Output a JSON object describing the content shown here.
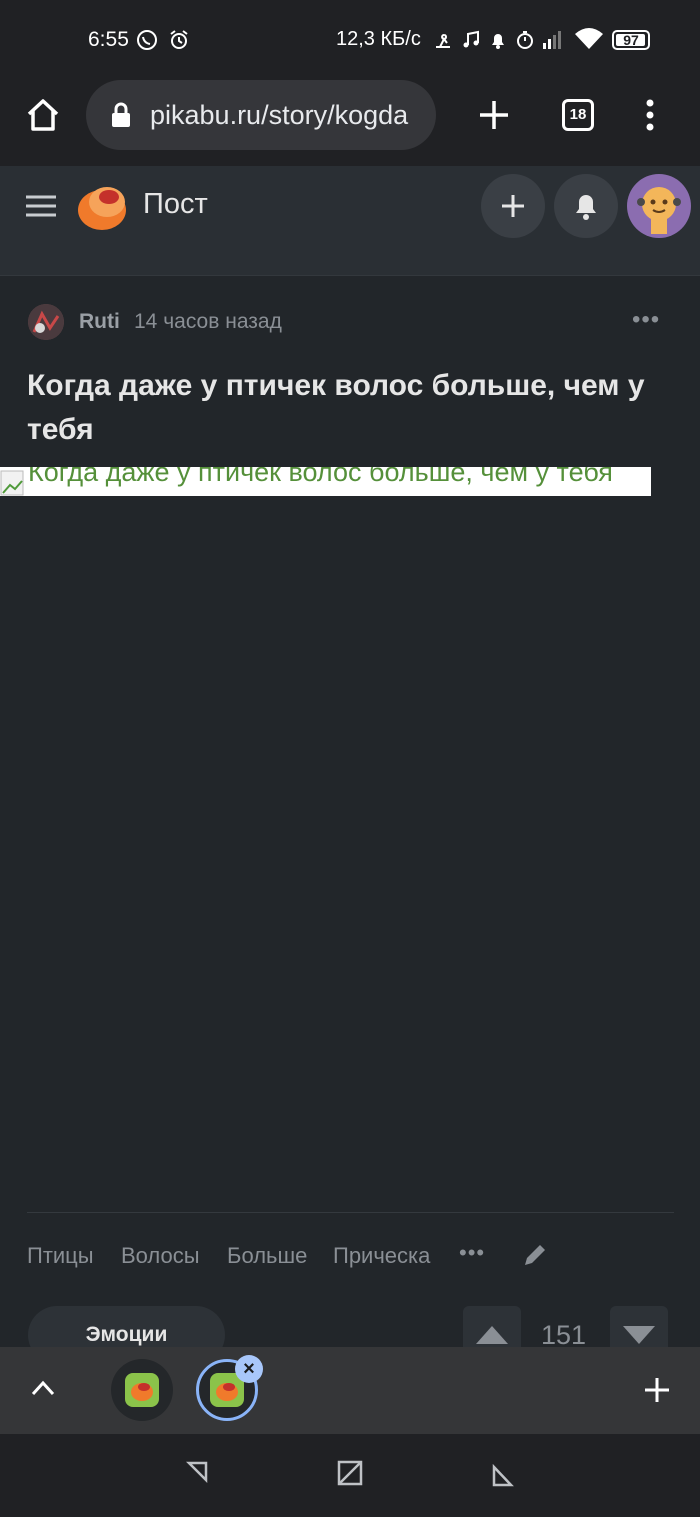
{
  "status_bar": {
    "time": "6:55",
    "network_speed": "12,3 КБ/с",
    "battery": "97",
    "battery_level_percent": 97
  },
  "browser": {
    "url": "pikabu.ru/story/kogda",
    "tab_count": "18"
  },
  "site_header": {
    "title": "Пост"
  },
  "post": {
    "author": "Ruti",
    "time_ago": "14 часов назад",
    "more": "•••",
    "title": "Когда даже у птичек волос больше, чем у тебя",
    "image_alt": "Когда даже у птичек волос больше, чем у тебя",
    "tags": [
      "Птицы",
      "Волосы",
      "Больше",
      "Прическа"
    ],
    "tags_more": "•••",
    "emotions_label": "Эмоции",
    "rating": "151"
  },
  "colors": {
    "background": "#22262a",
    "header": "#2a2f34",
    "accent_orange": "#f07a2b",
    "tab_highlight": "#8ab4f8"
  }
}
